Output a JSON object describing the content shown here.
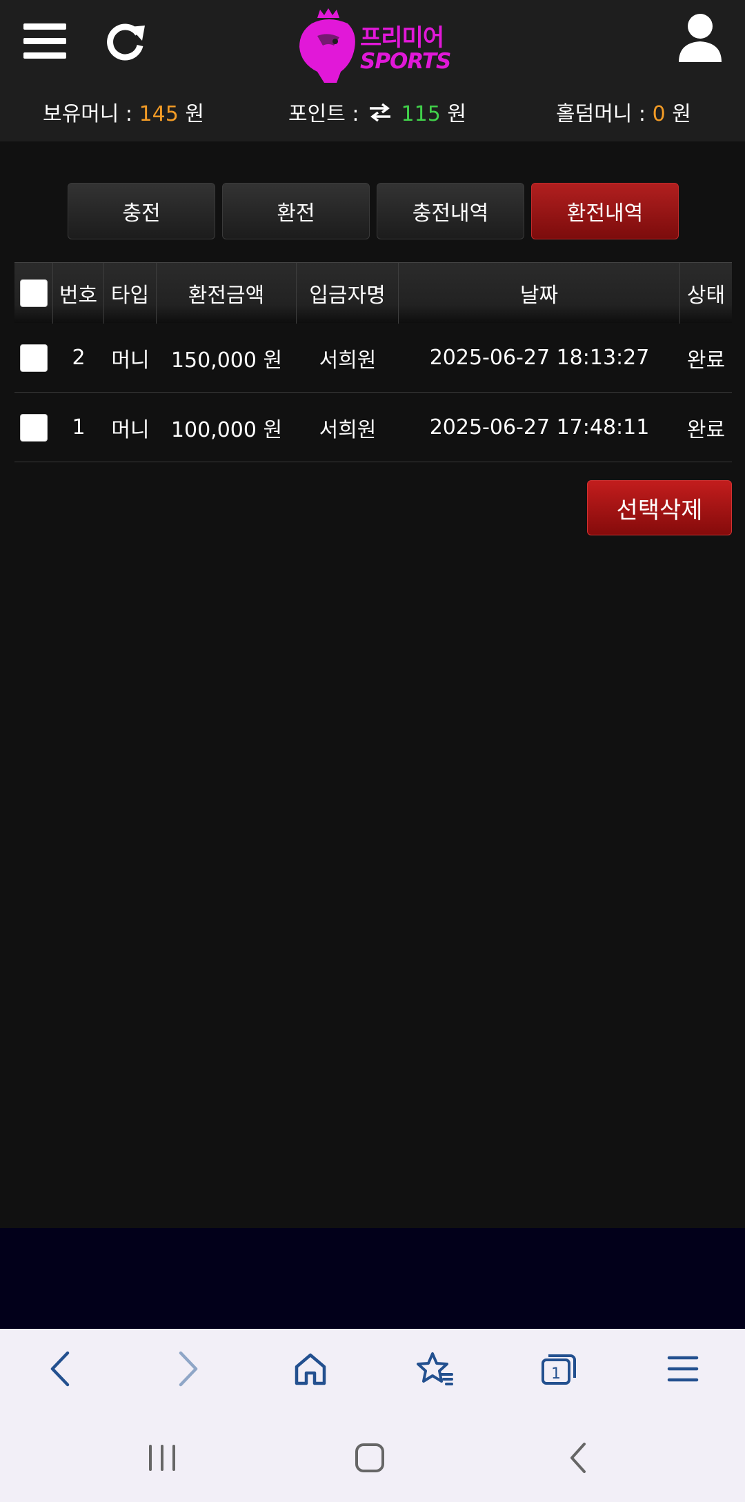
{
  "header": {
    "logo": {
      "line1": "프리미어",
      "line2": "SPORTS"
    },
    "balances": {
      "money_label": "보유머니 :",
      "money_value": "145",
      "money_unit": "원",
      "point_label": "포인트 :",
      "point_value": "115",
      "point_unit": "원",
      "holdem_label": "홀덤머니 :",
      "holdem_value": "0",
      "holdem_unit": "원"
    }
  },
  "tabs": [
    {
      "label": "충전"
    },
    {
      "label": "환전"
    },
    {
      "label": "충전내역"
    },
    {
      "label": "환전내역"
    }
  ],
  "table": {
    "columns": [
      "번호",
      "타입",
      "환전금액",
      "입금자명",
      "날짜",
      "상태"
    ],
    "rows": [
      {
        "no": "2",
        "type": "머니",
        "amount": "150,000 원",
        "name": "서희원",
        "date": "2025-06-27 18:13:27",
        "status": "완료"
      },
      {
        "no": "1",
        "type": "머니",
        "amount": "100,000 원",
        "name": "서희원",
        "date": "2025-06-27 17:48:11",
        "status": "완료"
      }
    ]
  },
  "actions": {
    "delete_selected": "선택삭제"
  },
  "colors": {
    "accent_red": "#9e1616",
    "money_orange": "#f29b26",
    "point_green": "#41d04a",
    "logo_magenta": "#e118d8",
    "browser_icon": "#23508f"
  },
  "icons": {
    "header": [
      "menu-icon",
      "refresh-icon",
      "user-icon"
    ],
    "browser": [
      "back-icon",
      "forward-icon",
      "home-icon",
      "bookmarks-icon",
      "tabs-icon",
      "browser-menu-icon"
    ],
    "system": [
      "recent-apps-icon",
      "home-button-icon",
      "system-back-icon"
    ]
  },
  "browser": {
    "tab_count": "1"
  }
}
